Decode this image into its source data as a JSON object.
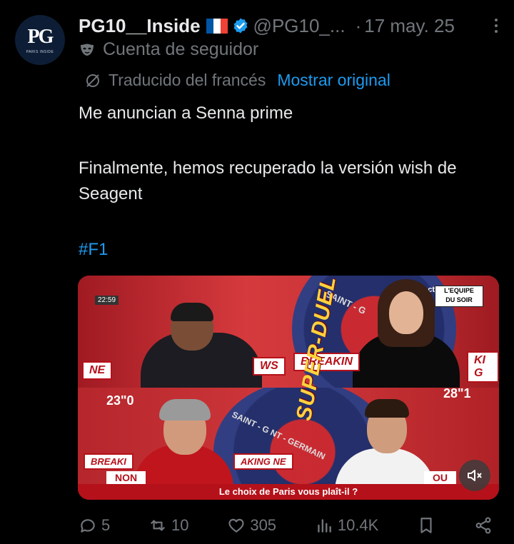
{
  "author": {
    "display_name": "PG10__Inside",
    "handle": "@PG10_...",
    "separator": "·",
    "date": "17 may. 25",
    "avatar_monogram": "PG",
    "avatar_subtext": "PARIS INSIDE",
    "account_label": "Cuenta de seguidor",
    "verified_color": "#1d9bf0",
    "flag_colors": [
      "#0055a4",
      "#ffffff",
      "#ef4135"
    ]
  },
  "translation": {
    "label": "Traducido del francés",
    "show_original": "Mostrar original"
  },
  "tweet": {
    "line1": "Me anuncian a Senna prime",
    "line2": "Finalmente, hemos recuperado la versión wish de Seagent",
    "hashtag": "#F1"
  },
  "media": {
    "clock": "22:59",
    "direct_label": "direct",
    "channel_top": "L'EQUIPE",
    "channel_bottom": "DU SOIR",
    "overlay_title": "SUPER-DUEL",
    "banner_left_top": "NE",
    "banner_mid_top": "WS",
    "banner_breaking_top": "BREAKIN",
    "banner_right_top": "KI G",
    "banner_left_bottom": "BREAKI",
    "banner_mid_bottom": "AKING NE",
    "timer_left": "23\"0",
    "timer_right": "28\"1",
    "tag_non_left": "NON",
    "tag_non_right": "OU",
    "caption": "Le choix de Paris vous plaît-il ?",
    "logo_top": "SAINT - G",
    "logo_bottom": "SAINT - G    NT - GERMAIN"
  },
  "actions": {
    "replies": "5",
    "reposts": "10",
    "likes": "305",
    "views": "10.4K"
  },
  "colors": {
    "background": "#000000",
    "text_primary": "#e7e9ea",
    "text_secondary": "#71767b",
    "link": "#1d9bf0"
  }
}
